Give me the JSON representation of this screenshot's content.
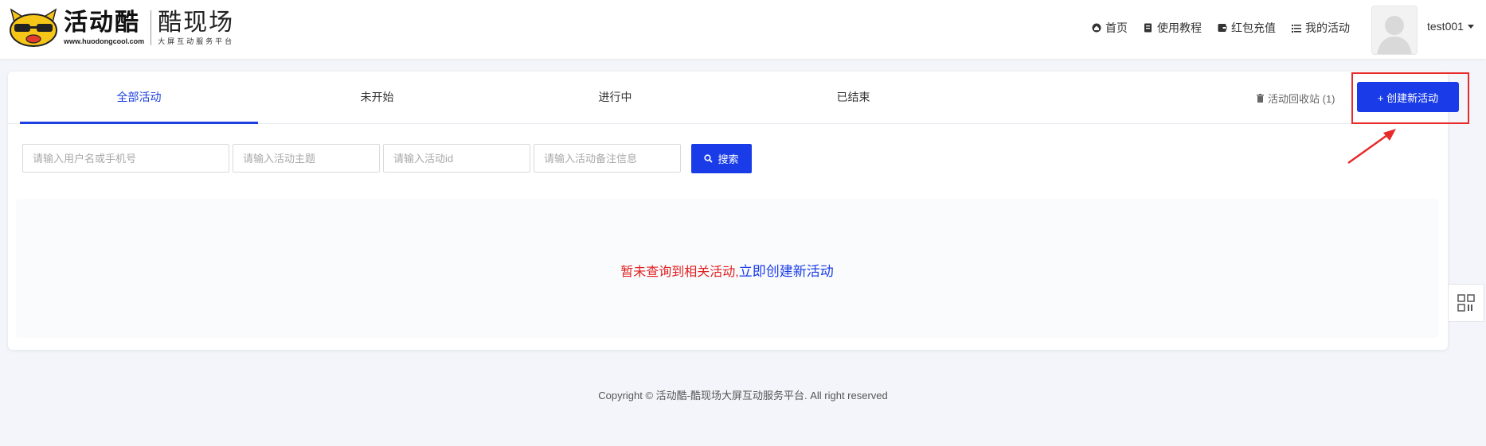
{
  "header": {
    "brand": "活动酷",
    "url": "www.huodongcool.com",
    "subtitle": "酷现场",
    "tagline": "大屏互动服务平台",
    "nav": [
      {
        "label": "首页",
        "icon": "home-icon"
      },
      {
        "label": "使用教程",
        "icon": "book-icon"
      },
      {
        "label": "红包充值",
        "icon": "wallet-icon"
      },
      {
        "label": "我的活动",
        "icon": "list-icon"
      }
    ],
    "username": "test001"
  },
  "tabs": [
    {
      "label": "全部活动",
      "active": true
    },
    {
      "label": "未开始",
      "active": false
    },
    {
      "label": "进行中",
      "active": false
    },
    {
      "label": "已结束",
      "active": false
    }
  ],
  "recycle_label": "活动回收站 (1)",
  "create_button": "+ 创建新活动",
  "filters": {
    "user_placeholder": "请输入用户名或手机号",
    "topic_placeholder": "请输入活动主题",
    "id_placeholder": "请输入活动id",
    "note_placeholder": "请输入活动备注信息",
    "search_label": "搜索"
  },
  "empty": {
    "message": "暂未查询到相关活动,",
    "link": "立即创建新活动"
  },
  "footer": "Copyright © 活动酷-酷现场大屏互动服务平台. All right reserved",
  "colors": {
    "accent": "#1a3ce8",
    "alert": "#e02020",
    "highlight_box": "#e82a2a"
  }
}
